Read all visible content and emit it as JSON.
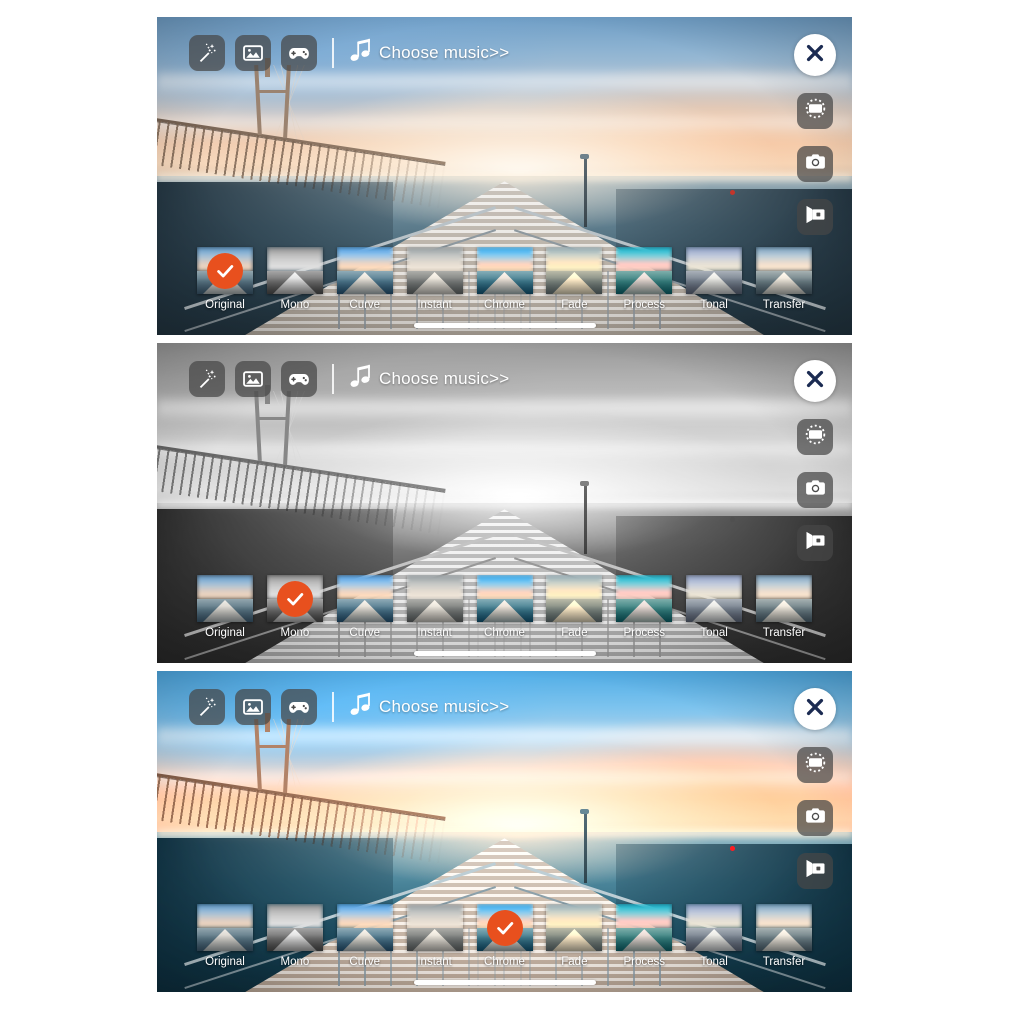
{
  "app": {
    "accent_color": "#E8501E",
    "close_color": "#1B2B52"
  },
  "toolbar": {
    "magic_wand_label": "magic-wand",
    "photo_label": "photo",
    "game_label": "game",
    "music_label": "music-note",
    "choose_music_text": "Choose music>>"
  },
  "right_rail": {
    "close_label": "close",
    "frame_label": "frame",
    "camera_label": "camera",
    "video_label": "video"
  },
  "filters": [
    {
      "id": "original",
      "label": "Original"
    },
    {
      "id": "mono",
      "label": "Mono"
    },
    {
      "id": "curve",
      "label": "Curve"
    },
    {
      "id": "instant",
      "label": "Instant"
    },
    {
      "id": "chrome",
      "label": "Chrome"
    },
    {
      "id": "fade",
      "label": "Fade"
    },
    {
      "id": "process",
      "label": "Process"
    },
    {
      "id": "tonal",
      "label": "Tonal"
    },
    {
      "id": "transfer",
      "label": "Transfer"
    }
  ],
  "panels": [
    {
      "id": "panel-1",
      "selected_filter": "original",
      "scene_mode": ""
    },
    {
      "id": "panel-2",
      "selected_filter": "mono",
      "scene_mode": "mono"
    },
    {
      "id": "panel-3",
      "selected_filter": "chrome",
      "scene_mode": "chrome"
    }
  ],
  "labels": {
    "p0f0": "Original",
    "p0f1": "Mono",
    "p0f2": "Curve",
    "p0f3": "Instant",
    "p0f4": "Chrome",
    "p0f5": "Fade",
    "p0f6": "Process",
    "p0f7": "Tonal",
    "p0f8": "Transfer",
    "p1f0": "Original",
    "p1f1": "Mono",
    "p1f2": "Curve",
    "p1f3": "Instant",
    "p1f4": "Chrome",
    "p1f5": "Fade",
    "p1f6": "Process",
    "p1f7": "Tonal",
    "p1f8": "Transfer",
    "p2f0": "Original",
    "p2f1": "Mono",
    "p2f2": "Curve",
    "p2f3": "Instant",
    "p2f4": "Chrome",
    "p2f5": "Fade",
    "p2f6": "Process",
    "p2f7": "Tonal",
    "p2f8": "Transfer",
    "music0": "Choose music>>",
    "music1": "Choose music>>",
    "music2": "Choose music>>"
  }
}
